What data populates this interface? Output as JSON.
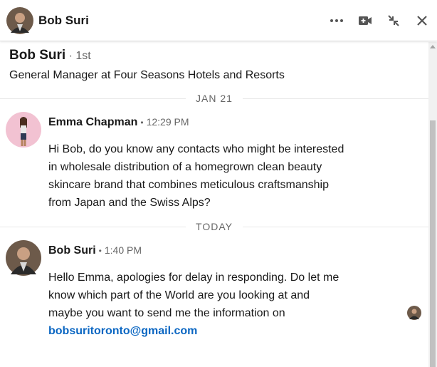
{
  "header": {
    "name": "Bob Suri",
    "icons": [
      "more-options-icon",
      "video-call-icon",
      "minimize-icon",
      "close-icon"
    ]
  },
  "profile": {
    "name": "Bob Suri",
    "degree": "1st",
    "headline": "General Manager at Four Seasons Hotels and Resorts"
  },
  "dividers": {
    "first": "JAN 21",
    "second": "TODAY"
  },
  "messages": [
    {
      "sender": "Emma Chapman",
      "time": "12:29 PM",
      "lines": [
        "Hi Bob, do you know any contacts who might be interested",
        "in wholesale distribution of a homegrown clean beauty",
        "skincare brand that combines meticulous craftsmanship",
        "from Japan and the Swiss Alps?"
      ]
    },
    {
      "sender": "Bob Suri",
      "time": "1:40 PM",
      "lines": [
        "Hello Emma, apologies for delay in responding. Do let me",
        "know which part of the World are you looking at and",
        "maybe you want to send me the information on"
      ],
      "link": "bobsuritoronto@gmail.com"
    }
  ],
  "colors": {
    "link": "#0a66c2",
    "muted": "#666666",
    "text": "#191919"
  }
}
